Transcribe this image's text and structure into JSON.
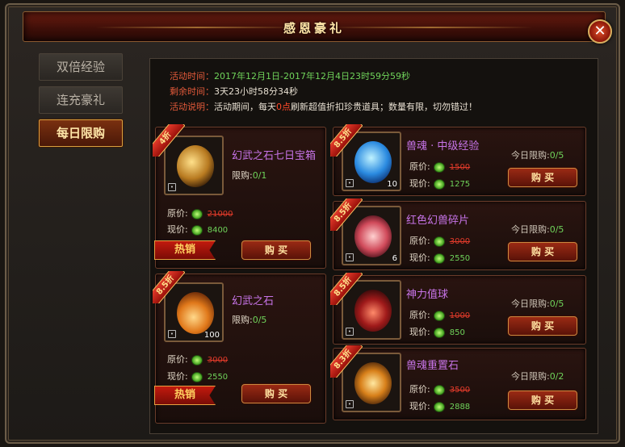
{
  "window": {
    "title": "感恩豪礼"
  },
  "sidebar": {
    "tabs": [
      {
        "label": "双倍经验"
      },
      {
        "label": "连充豪礼"
      },
      {
        "label": "每日限购"
      }
    ]
  },
  "info": {
    "time_label": "活动时间：",
    "time_value": "2017年12月1日-2017年12月4日23时59分59秒",
    "remain_label": "剩余时间：",
    "remain_value": "3天23小时58分34秒",
    "desc_label": "活动说明：",
    "desc_pre": "活动期间，每天",
    "desc_hl": "0点",
    "desc_post": "刷新超值折扣珍贵道具；数量有限，切勿错过！"
  },
  "labels": {
    "orig": "原价:",
    "now": "现价:",
    "buy": "购 买",
    "hot": "热销",
    "limit_prefix": "限购:",
    "daily_prefix": "今日限购:"
  },
  "items": [
    {
      "name": "幻武之石七日宝箱",
      "discount": "4折",
      "limit": "0/1",
      "orig": "21000",
      "now": "8400",
      "count": "",
      "hot": true
    },
    {
      "name": "幻武之石",
      "discount": "8.5折",
      "limit": "0/5",
      "orig": "3000",
      "now": "2550",
      "count": "100",
      "hot": true
    },
    {
      "name": "兽魂 · 中级经验",
      "discount": "8.5折",
      "limit": "0/5",
      "orig": "1500",
      "now": "1275",
      "count": "10"
    },
    {
      "name": "红色幻兽碎片",
      "discount": "8.5折",
      "limit": "0/5",
      "orig": "3000",
      "now": "2550",
      "count": "6"
    },
    {
      "name": "神力值球",
      "discount": "8.5折",
      "limit": "0/5",
      "orig": "1000",
      "now": "850",
      "count": ""
    },
    {
      "name": "兽魂重置石",
      "discount": "8.3折",
      "limit": "0/2",
      "orig": "3500",
      "now": "2888",
      "count": ""
    }
  ],
  "icons": {
    "close": "close-icon",
    "coin": "gem-coin-icon",
    "lock": "bind-lock-icon"
  }
}
